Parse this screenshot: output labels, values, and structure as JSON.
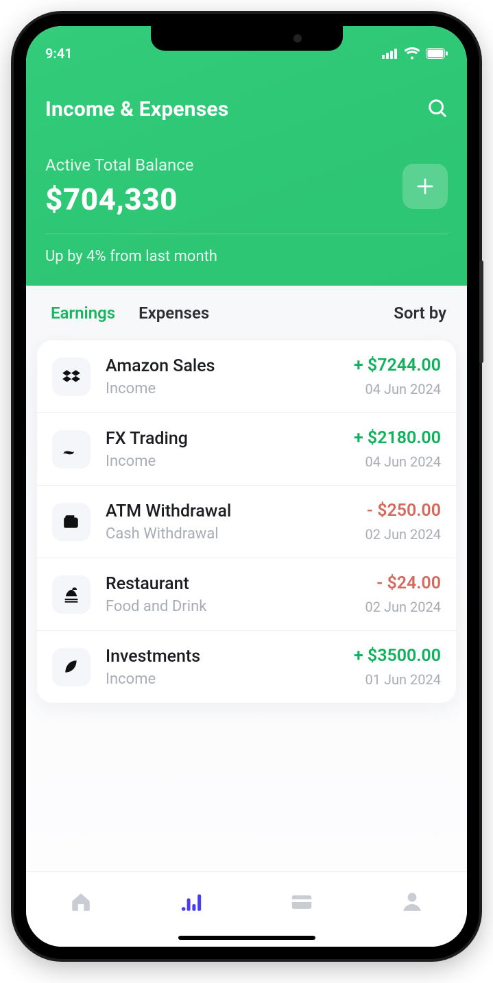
{
  "status": {
    "time": "9:41"
  },
  "header": {
    "title": "Income & Expenses",
    "balance_label": "Active Total Balance",
    "balance_value": "$704,330",
    "delta_text": "Up by 4% from last month"
  },
  "tabs": {
    "earnings": "Earnings",
    "expenses": "Expenses",
    "sort": "Sort by"
  },
  "transactions": [
    {
      "title": "Amazon Sales",
      "subtitle": "Income",
      "amount": "+ $7244.00",
      "direction": "pos",
      "date": "04 Jun 2024",
      "icon": "dropbox-icon"
    },
    {
      "title": "FX Trading",
      "subtitle": "Income",
      "amount": "+ $2180.00",
      "direction": "pos",
      "date": "04 Jun 2024",
      "icon": "trade-icon"
    },
    {
      "title": "ATM Withdrawal",
      "subtitle": "Cash Withdrawal",
      "amount": "- $250.00",
      "direction": "neg",
      "date": "02 Jun 2024",
      "icon": "wallet-icon"
    },
    {
      "title": "Restaurant",
      "subtitle": "Food and Drink",
      "amount": "- $24.00",
      "direction": "neg",
      "date": "02 Jun 2024",
      "icon": "food-icon"
    },
    {
      "title": "Investments",
      "subtitle": "Income",
      "amount": "+ $3500.00",
      "direction": "pos",
      "date": "01 Jun 2024",
      "icon": "leaf-icon"
    }
  ]
}
